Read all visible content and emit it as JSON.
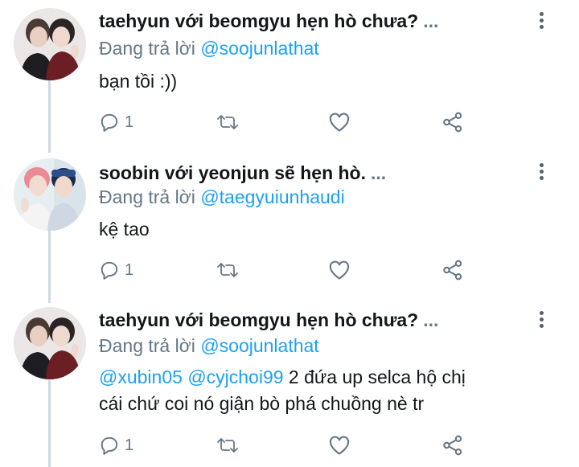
{
  "tweets": [
    {
      "name": "taehyun với beomgyu hẹn hò chưa?",
      "ellipsis": "...",
      "reply_prefix": "Đang trả lời ",
      "reply_handle": "@soojunlathat",
      "text": "bạn tồi :))",
      "mention1": "",
      "mention2": "",
      "replies": "1",
      "avatar": "avatar-photo-two-people"
    },
    {
      "name": "soobin với yeonjun sẽ hẹn hò.",
      "ellipsis": "...",
      "reply_prefix": "Đang trả lời ",
      "reply_handle": "@taegyuiunhaudi",
      "text": "kệ tao",
      "mention1": "",
      "mention2": "",
      "replies": "1",
      "avatar": "avatar-photo-two-people"
    },
    {
      "name": "taehyun với beomgyu hẹn hò chưa?",
      "ellipsis": "...",
      "reply_prefix": "Đang trả lời ",
      "reply_handle": "@soojunlathat",
      "mention1": "@xubin05",
      "mention2": "@cyjchoi99",
      "text_line1": " 2 đứa up selca hộ chị",
      "text_line2": "cái chứ coi nó giận bò phá chuồng nè tr",
      "replies": "1",
      "avatar": "avatar-photo-two-people"
    }
  ],
  "icons": {
    "reply": "reply-icon",
    "retweet": "retweet-icon",
    "like": "heart-icon",
    "share": "share-icon",
    "more": "more-vertical-icon"
  },
  "colors": {
    "link": "#1da1f2",
    "secondary": "#657786",
    "thread_line": "#cfd9de"
  }
}
